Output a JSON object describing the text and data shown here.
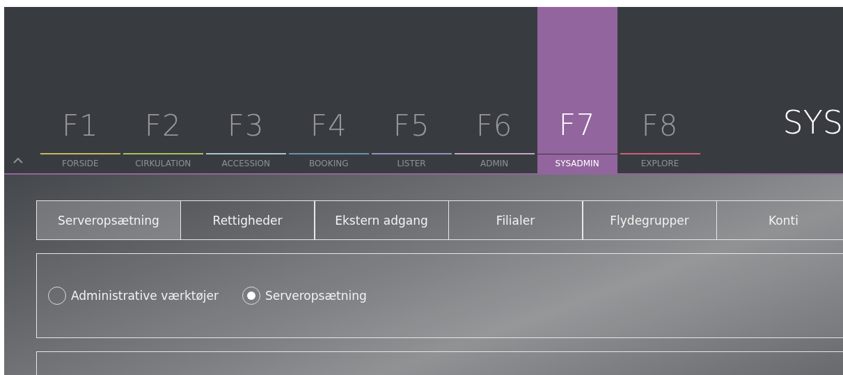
{
  "fkeys": [
    {
      "key": "F1",
      "label": "FORSIDE",
      "color": "#c8b85c",
      "selected": false
    },
    {
      "key": "F2",
      "label": "CIRKULATION",
      "color": "#a6c25e",
      "selected": false
    },
    {
      "key": "F3",
      "label": "ACCESSION",
      "color": "#a9c6cf",
      "selected": false
    },
    {
      "key": "F4",
      "label": "BOOKING",
      "color": "#6d93a9",
      "selected": false
    },
    {
      "key": "F5",
      "label": "LISTER",
      "color": "#9393c2",
      "selected": false
    },
    {
      "key": "F6",
      "label": "ADMIN",
      "color": "#c9a2c8",
      "selected": false
    },
    {
      "key": "F7",
      "label": "SYSADMIN",
      "color": "#93659e",
      "selected": true
    },
    {
      "key": "F8",
      "label": "EXPLORE",
      "color": "#cf6273",
      "selected": false
    }
  ],
  "page_title": "SYS",
  "subtabs": [
    {
      "label": "Serveropsætning",
      "selected": true
    },
    {
      "label": "Rettigheder",
      "selected": false
    },
    {
      "label": "Ekstern adgang",
      "selected": false
    },
    {
      "label": "Filialer",
      "selected": false
    },
    {
      "label": "Flydegrupper",
      "selected": false
    },
    {
      "label": "Konti",
      "selected": false
    }
  ],
  "radios": [
    {
      "label": "Administrative værktøjer",
      "selected": false
    },
    {
      "label": "Serveropsætning",
      "selected": true
    }
  ]
}
